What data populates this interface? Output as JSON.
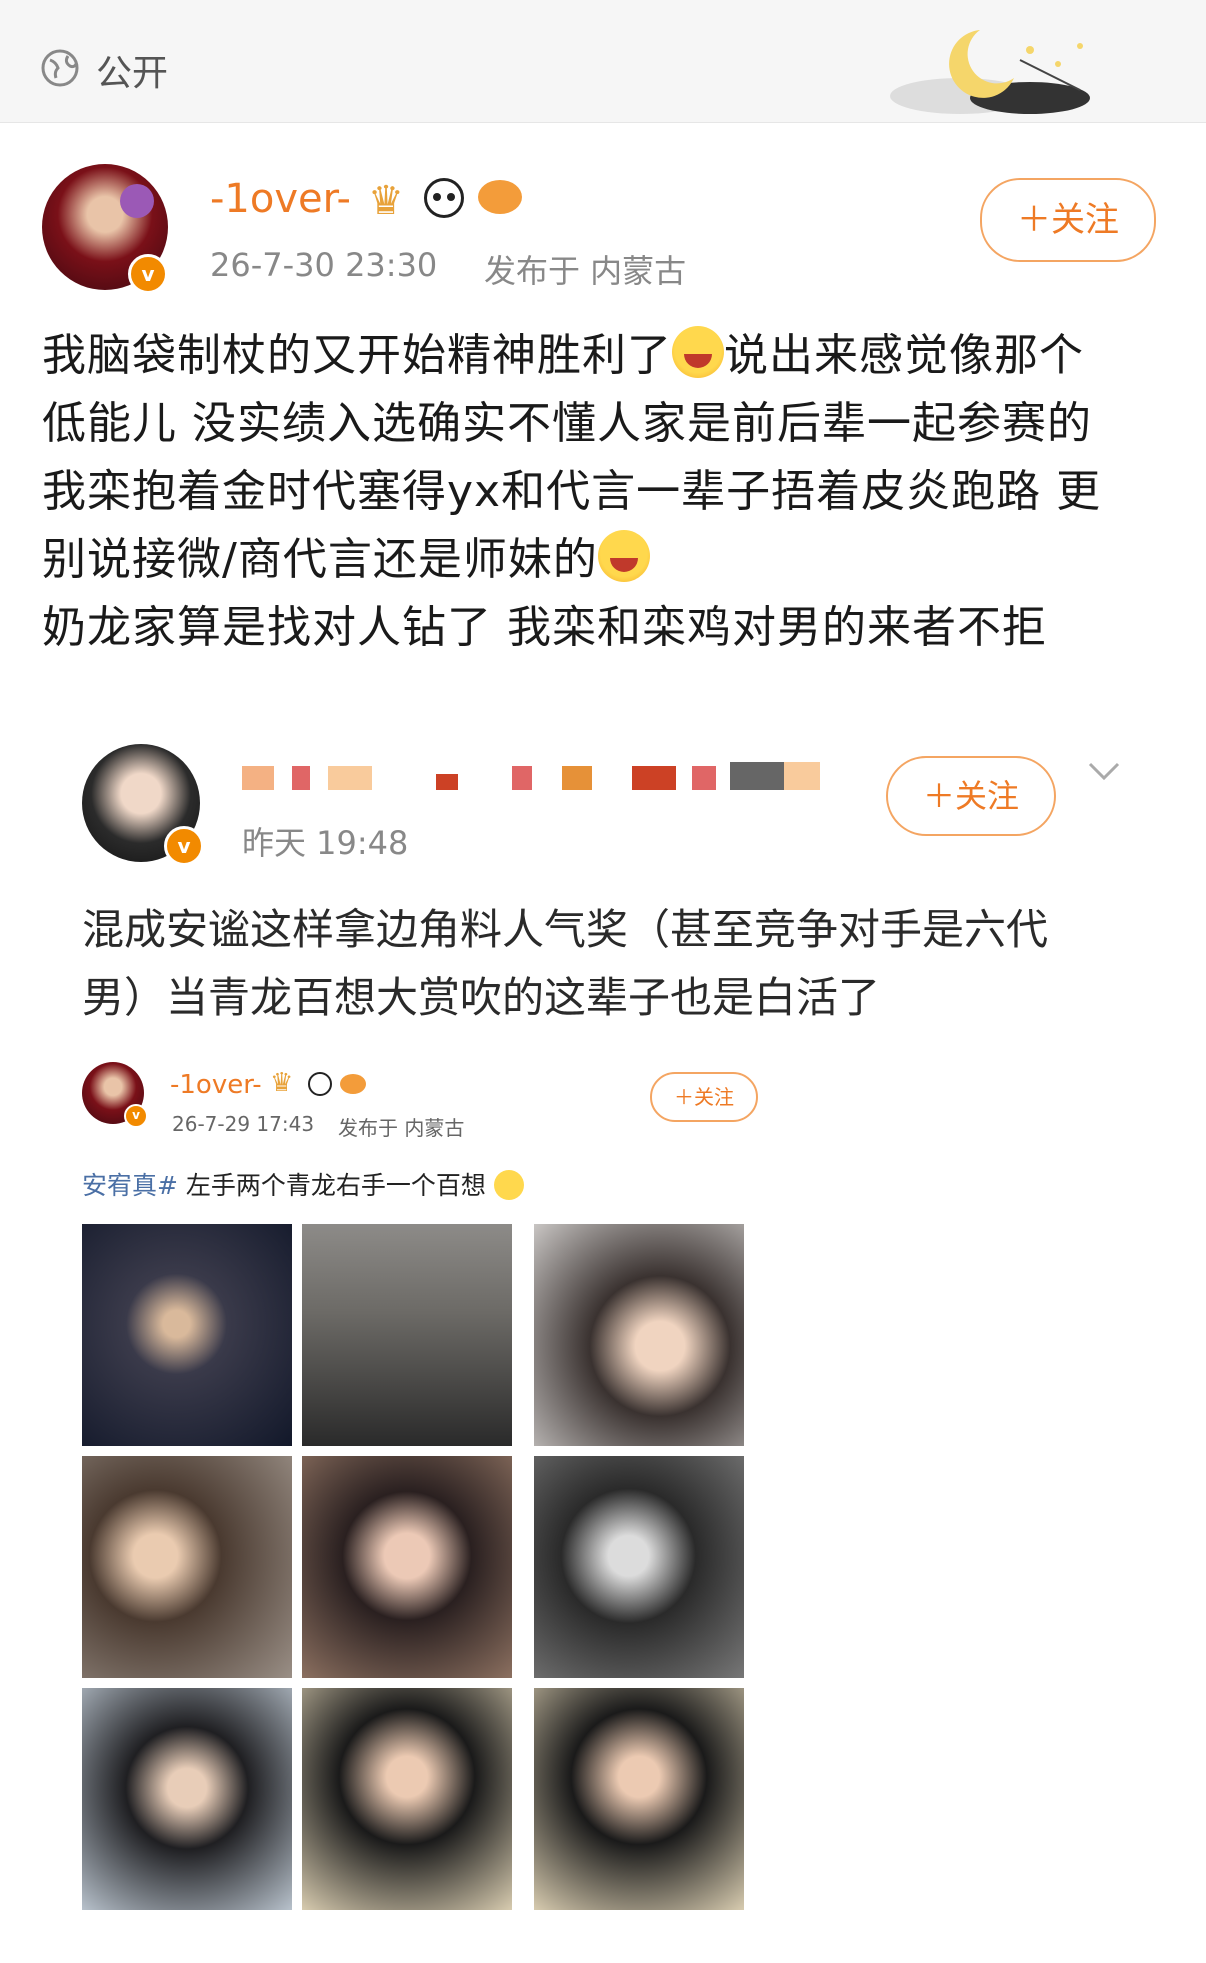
{
  "topbar": {
    "visibility": "公开",
    "globe_icon": "globe-icon",
    "decoration": "moon-stars-decoration"
  },
  "post": {
    "author": "-1over-",
    "time": "26-7-30 23:30",
    "location": "发布于 内蒙古",
    "follow": "＋关注",
    "lines": {
      "l1a": "我脑袋制杖的又开始精神胜利了",
      "l1b": "说出来感觉像那个",
      "l2": "低能儿 没实绩入选确实不懂人家是前后辈一起参赛的",
      "l3": "我栾抱着金时代塞得yx和代言一辈子捂着皮炎跑路 更",
      "l4": "别说接微/商代言还是师妹的",
      "l5": "奶龙家算是找对人钻了 我栾和栾鸡对男的来者不拒"
    },
    "emoji": "laugh-cry-emoji"
  },
  "quote": {
    "time": "昨天 19:48",
    "follow": "＋关注",
    "line1": "混成安谧这样拿边角料人气奖（甚至竞争对手是六代",
    "line2": "男）当青龙百想大赏吹的这辈子也是白活了"
  },
  "inner": {
    "author": "-1over-",
    "time": "26-7-29 17:43",
    "location": "发布于 内蒙古",
    "follow": "＋关注",
    "tag": "安宥真#",
    "text": " 左手两个青龙右手一个百想"
  },
  "colors": {
    "accent": "#ee7a25",
    "badge": "#f28a00",
    "link": "#4a6fa5"
  }
}
